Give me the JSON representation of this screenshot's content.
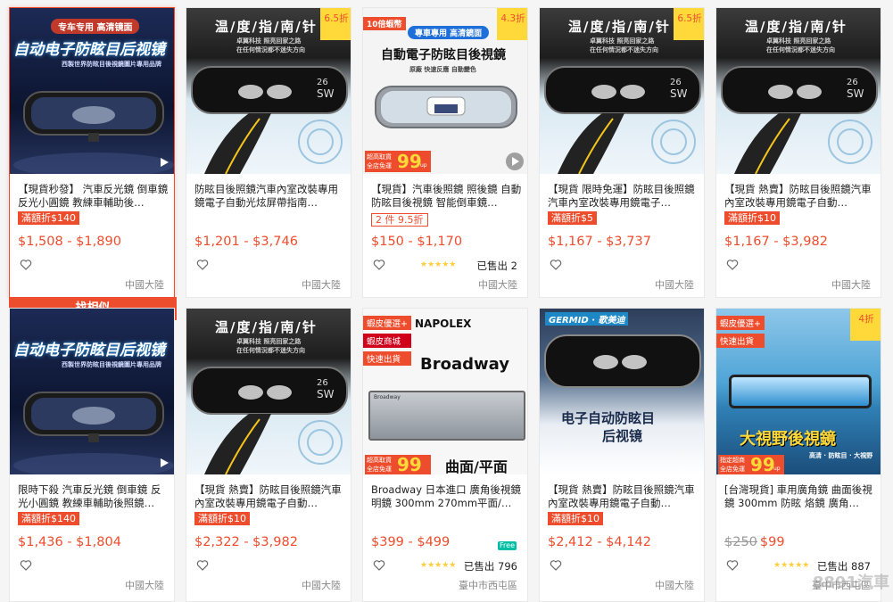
{
  "action": {
    "find_similar": "找相似"
  },
  "location_default": "中國大陸",
  "cards": [
    {
      "img": {
        "banner": "专车专用 高清镜面",
        "title": "自动电子防眩目后视镜",
        "sub": "西製世界防眩目後視鏡圖片專用品牌"
      },
      "title": "【現貨秒發】 汽車反光鏡 倒車鏡 反光小圓鏡 教練車輔助後…",
      "promo": "滿額折$140",
      "price": "$1,508 - $1,890",
      "location": "中國大陸"
    },
    {
      "img": {
        "title": "温/度/指/南/针",
        "line1": "卓翼科技 照亮回家之路",
        "line2": "在任何情況都不迷失方向"
      },
      "discount": "6.5折",
      "title": "防眩目後照鏡汽車內室改裝專用鏡電子自動光炫屏帶指南…",
      "price": "$1,201 - $3,746",
      "location": "中國大陸"
    },
    {
      "img": {
        "ribbon": "10倍蝦幣",
        "banner": "專車專用 高清鏡面",
        "title": "自動電子防眩目後視鏡",
        "sub": "原廠 快速反應 自動變色",
        "free_a": "超高取貨",
        "free_b": "全店免運",
        "free_num": "99",
        "free_up": "up"
      },
      "discount": "4.3折",
      "title": "【現貨】汽車後照鏡 照後鏡 自動防眩目後視鏡 智能倒車鏡…",
      "promo_outline": "2 件 9.5折",
      "price": "$150 - $1,170",
      "rating": "★★★★★",
      "sold": "已售出 2",
      "location": "中國大陸"
    },
    {
      "img": {
        "title": "温/度/指/南/针",
        "line1": "卓翼科技 照亮回家之路",
        "line2": "在任何情況都不迷失方向"
      },
      "discount": "6.5折",
      "title": "【現貨 限時免運】防眩目後照鏡汽車內室改裝專用鏡電子…",
      "promo": "滿額折$5",
      "price": "$1,167 - $3,737",
      "location": "中國大陸"
    },
    {
      "img": {
        "title": "温/度/指/南/针",
        "line1": "卓翼科技 照亮回家之路",
        "line2": "在任何情況都不迷失方向"
      },
      "title": "【現貨 熱賣】防眩目後照鏡汽車內室改裝專用鏡電子自動…",
      "promo": "滿額折$10",
      "price": "$1,167 - $3,982",
      "location": "中國大陸"
    },
    {
      "img": {
        "title": "自动电子防眩目后视镜",
        "sub": "西製世界防眩目後視鏡圖片專用品牌"
      },
      "title": "限時下殺 汽車反光鏡 倒車鏡 反光小圓鏡 教練車輔助後照鏡…",
      "promo": "滿額折$140",
      "price": "$1,436 - $1,804",
      "location": "中國大陸"
    },
    {
      "img": {
        "title": "温/度/指/南/针",
        "line1": "卓翼科技 照亮回家之路",
        "line2": "在任何情況都不迷失方向"
      },
      "title": "【現貨 熱賣】防眩目後照鏡汽車內室改裝專用鏡電子自動…",
      "promo": "滿額折$10",
      "price": "$2,322 - $3,982",
      "location": "中國大陸"
    },
    {
      "img": {
        "badge1": "蝦皮優選+",
        "badge2": "蝦皮商城",
        "badge3": "快速出貨",
        "brand": "NAPOLEX",
        "brand2": "Broadway",
        "mirror_label": "Broadway",
        "bottom": "曲面/平面",
        "free_a": "超高取貨",
        "free_b": "全店免運",
        "free_num": "99"
      },
      "title": "Broadway 日本進口 廣角後視鏡 明鏡 300mm 270mm平面/…",
      "price": "$399 - $499",
      "free": "Free",
      "rating": "★★★★★",
      "sold": "已售出 796",
      "location": "臺中市西屯區"
    },
    {
      "img": {
        "brand": "GERMID · 歌美迪",
        "title": "电子自动防眩目",
        "title2": "后视镜"
      },
      "title": "【現貨 熱賣】防眩目後照鏡汽車內室改裝專用鏡電子自動…",
      "promo": "滿額折$10",
      "price": "$2,412 - $4,142",
      "location": "中國大陸"
    },
    {
      "img": {
        "badge1": "蝦皮優選+",
        "badge2": "快速出貨",
        "title": "大視野後視鏡",
        "sub": "高清 · 防眩目 · 大視野",
        "free_a": "指定超商",
        "free_b": "全店免運",
        "free_num": "99",
        "free_up": "up"
      },
      "discount": "4折",
      "title": "[台灣現貨] 車用廣角鏡 曲面後視鏡 300mm 防眩 烙鏡 廣角…",
      "price_old": "$250",
      "price": "$99",
      "rating": "★★★★★",
      "sold": "已售出 887",
      "location": "臺中市西屯區"
    }
  ],
  "watermark": "8891汽車",
  "colors": {
    "brand": "#ee4d2d",
    "star": "#ffce3d",
    "discount_bg": "#ffd839"
  }
}
